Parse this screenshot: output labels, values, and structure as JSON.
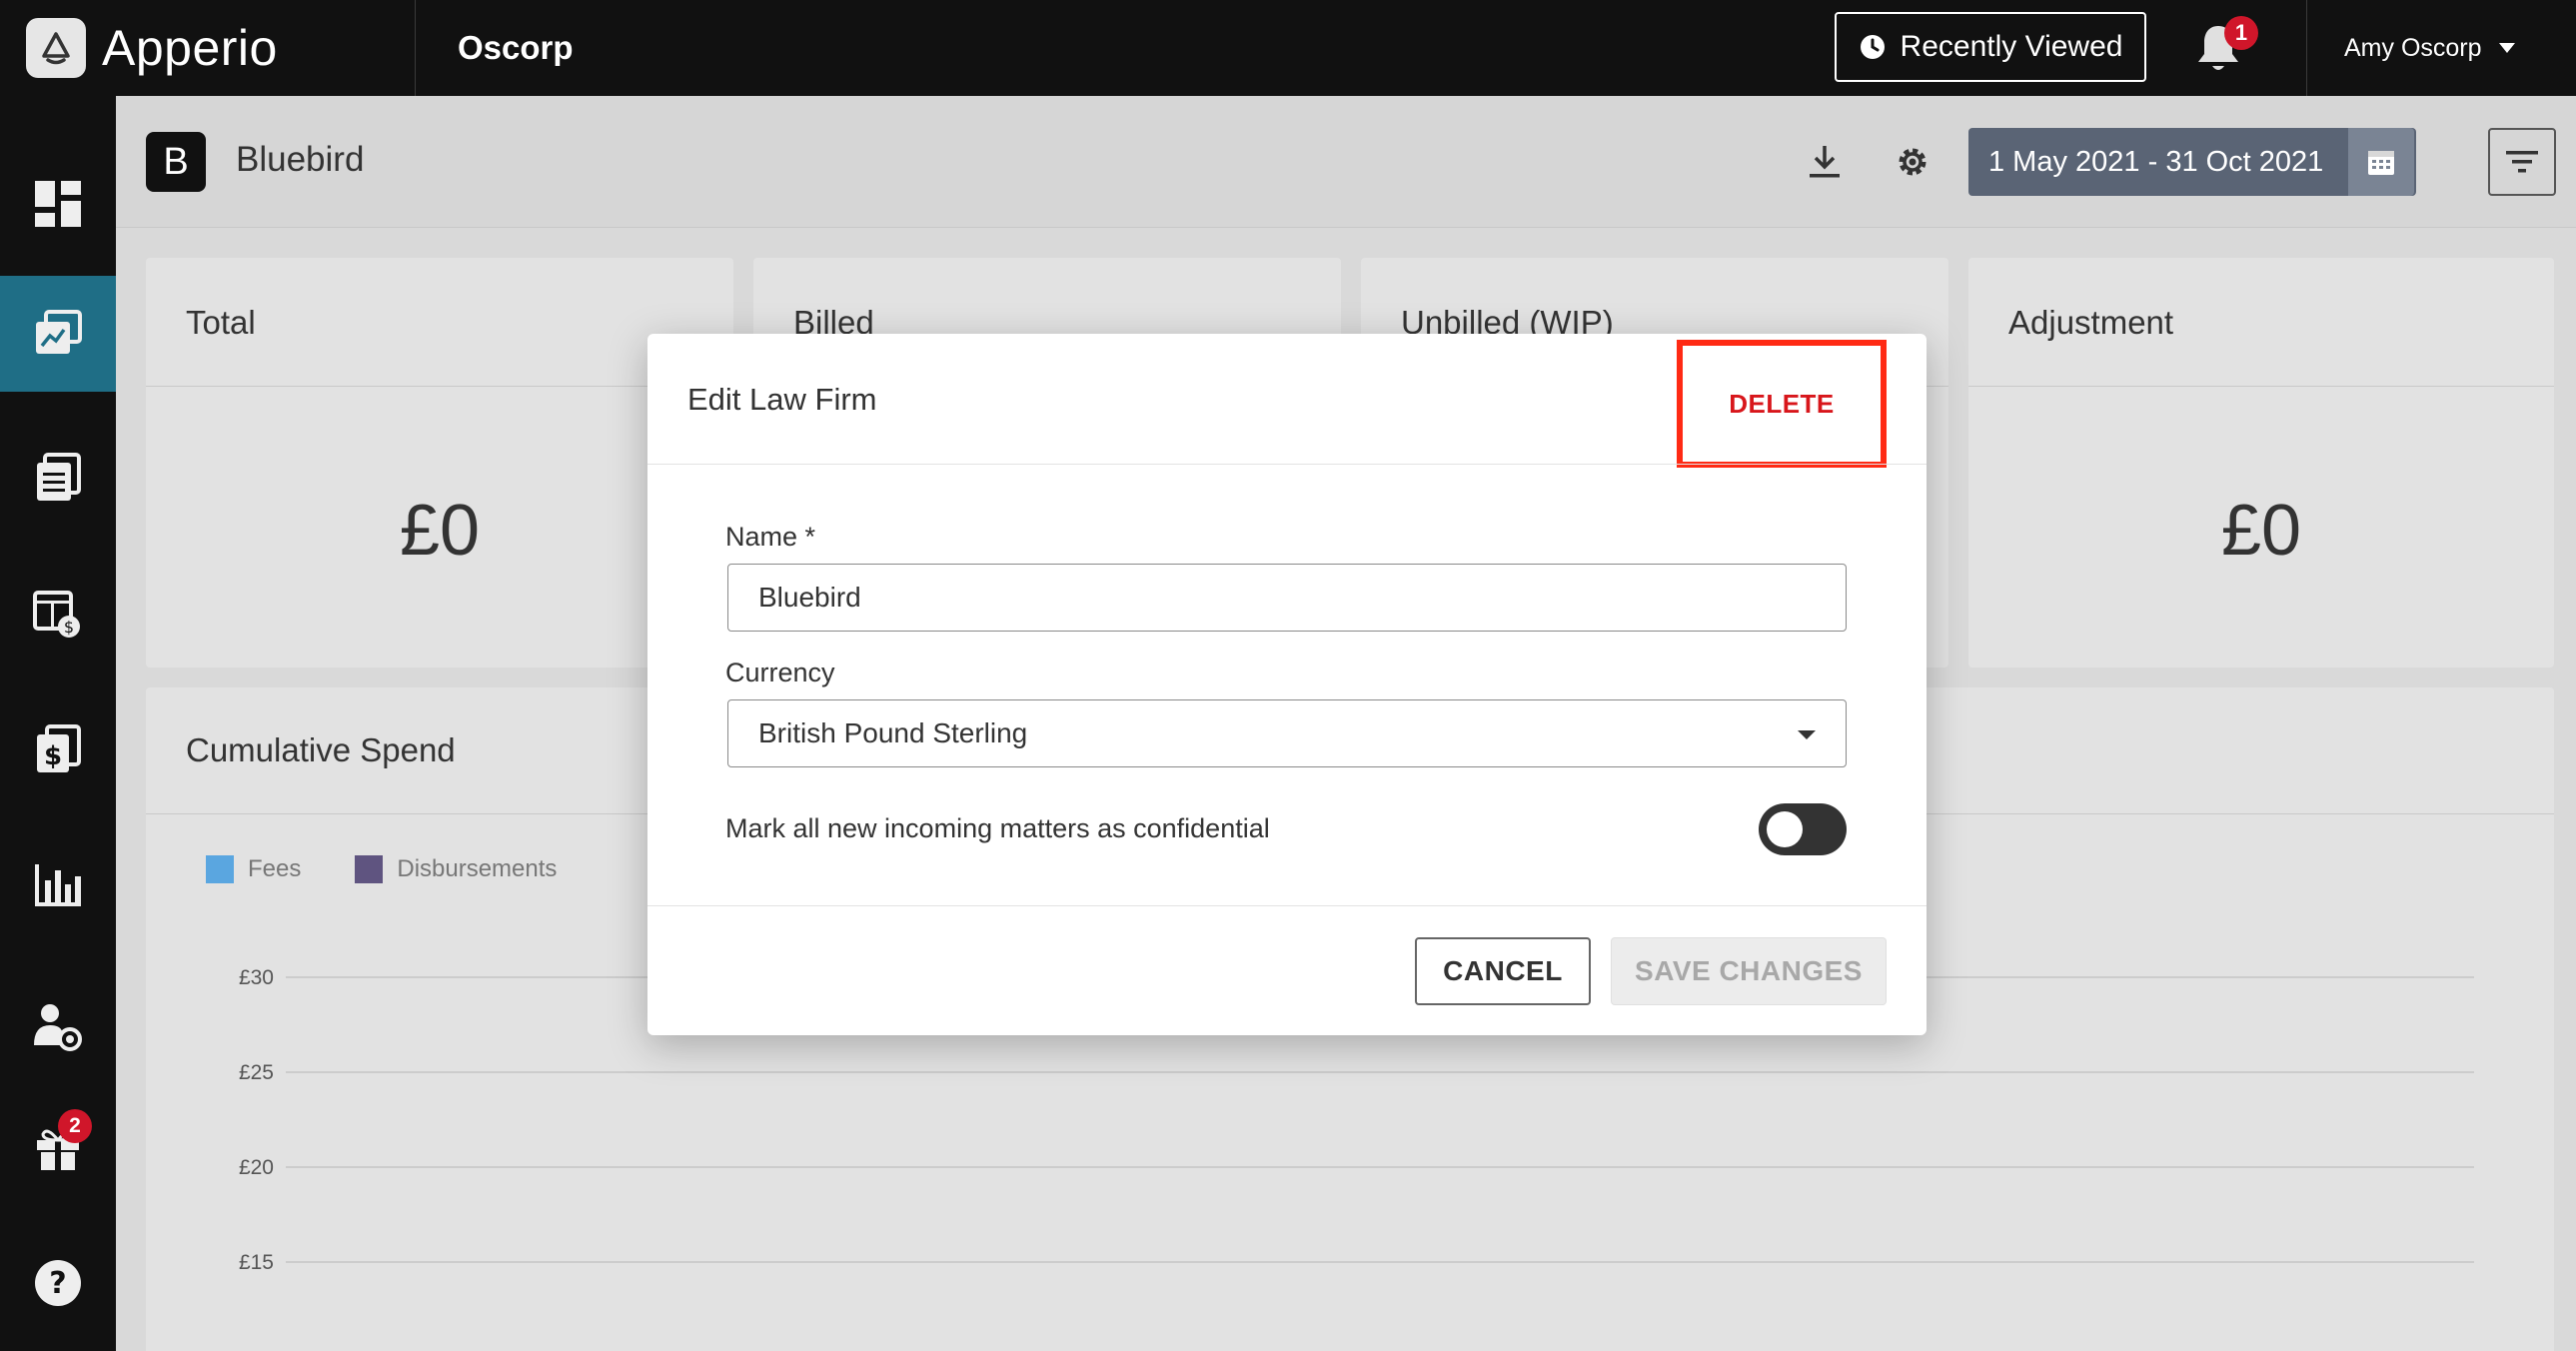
{
  "app": {
    "name": "Apperio",
    "org": "Oscorp"
  },
  "topbar": {
    "recently_viewed": "Recently Viewed",
    "notification_count": "1",
    "user_name": "Amy Oscorp"
  },
  "sidebar": {
    "items": [
      {
        "icon": "dashboard-icon"
      },
      {
        "icon": "analytics-icon",
        "active": true
      },
      {
        "icon": "documents-icon"
      },
      {
        "icon": "budget-icon"
      },
      {
        "icon": "invoices-icon"
      },
      {
        "icon": "bar-chart-icon"
      },
      {
        "icon": "user-settings-icon"
      },
      {
        "icon": "gift-icon",
        "badge": "2"
      },
      {
        "icon": "help-icon"
      }
    ]
  },
  "header": {
    "matter_initial": "B",
    "matter_name": "Bluebird",
    "date_range": "1 May 2021 - 31 Oct 2021"
  },
  "cards": [
    {
      "title": "Total",
      "value": "£0"
    },
    {
      "title": "Billed",
      "value": ""
    },
    {
      "title": "Unbilled (WIP)",
      "value": ""
    },
    {
      "title": "Adjustment",
      "value": "£0"
    }
  ],
  "spend": {
    "title": "Cumulative Spend",
    "legend": [
      {
        "name": "Fees",
        "color": "#5aa6e0"
      },
      {
        "name": "Disbursements",
        "color": "#5f5480"
      }
    ]
  },
  "chart_data": {
    "type": "area",
    "title": "Cumulative Spend",
    "series": [
      {
        "name": "Fees",
        "values": []
      },
      {
        "name": "Disbursements",
        "values": []
      }
    ],
    "yticks": [
      "£30",
      "£25",
      "£20",
      "£15"
    ],
    "grid": true,
    "legend_position": "top-left"
  },
  "modal": {
    "title": "Edit Law Firm",
    "delete_label": "DELETE",
    "name_label": "Name *",
    "name_value": "Bluebird",
    "currency_label": "Currency",
    "currency_value": "British Pound Sterling",
    "confidential_label": "Mark all new incoming matters as confidential",
    "confidential_on": false,
    "cancel_label": "CANCEL",
    "save_label": "SAVE CHANGES"
  },
  "colors": {
    "accent": "#1f6e86",
    "topbar": "#111111",
    "danger": "#d8161b",
    "highlight": "#ff2a14"
  }
}
